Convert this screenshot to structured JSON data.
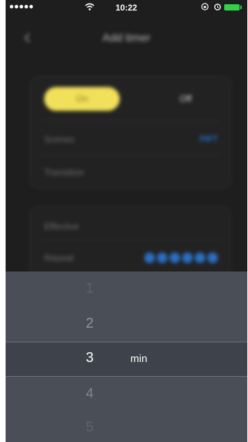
{
  "status_bar": {
    "time": "10:22",
    "icons": [
      "signal-dots-icon",
      "wifi-icon",
      "rotation-lock-icon",
      "alarm-icon",
      "battery-icon"
    ],
    "battery_color": "#35d04a"
  },
  "nav": {
    "title": "Add timer",
    "back_icon": "chevron-left-icon"
  },
  "schedule_card": {
    "on_label": "On",
    "off_label": "Off",
    "scenes_label": "Scenes",
    "scenes_value": "PIFT",
    "transition_label": "Transition"
  },
  "repeat_card": {
    "effective_label": "Effective",
    "repeat_label": "Repeat"
  },
  "picker": {
    "options": [
      "1",
      "2",
      "3",
      "4",
      "5"
    ],
    "selected": "3",
    "unit": "min"
  },
  "colors": {
    "accent_yellow": "#f1e05a",
    "accent_blue": "#1f6fd0",
    "picker_bg": "#4a4e57"
  }
}
